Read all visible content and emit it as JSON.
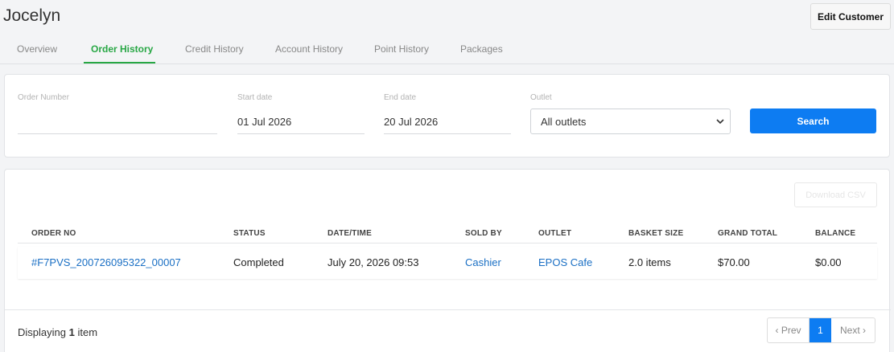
{
  "header": {
    "customer_name": "Jocelyn",
    "edit_button": "Edit Customer"
  },
  "tabs": [
    {
      "label": "Overview",
      "active": false
    },
    {
      "label": "Order History",
      "active": true
    },
    {
      "label": "Credit History",
      "active": false
    },
    {
      "label": "Account History",
      "active": false
    },
    {
      "label": "Point History",
      "active": false
    },
    {
      "label": "Packages",
      "active": false
    }
  ],
  "filters": {
    "order_number": {
      "label": "Order Number",
      "value": ""
    },
    "start_date": {
      "label": "Start date",
      "value": "01 Jul 2026"
    },
    "end_date": {
      "label": "End date",
      "value": "20 Jul 2026"
    },
    "outlet": {
      "label": "Outlet",
      "selected": "All outlets"
    },
    "search_button": "Search"
  },
  "results": {
    "download_button": "Download CSV",
    "columns": [
      "ORDER NO",
      "STATUS",
      "DATE/TIME",
      "SOLD BY",
      "OUTLET",
      "BASKET SIZE",
      "GRAND TOTAL",
      "BALANCE"
    ],
    "rows": [
      {
        "order_no": "#F7PVS_200726095322_00007",
        "status": "Completed",
        "datetime": "July 20, 2026 09:53",
        "sold_by": "Cashier",
        "outlet": "EPOS Cafe",
        "basket_size": "2.0 items",
        "grand_total": "$70.00",
        "balance": "$0.00"
      }
    ],
    "displaying_prefix": "Displaying",
    "displaying_count": "1",
    "displaying_suffix": "item"
  },
  "pagination": {
    "prev": "‹ Prev",
    "current_page": "1",
    "next": "Next ›"
  },
  "colors": {
    "accent_green": "#28a745",
    "primary_blue": "#0d7cf2",
    "link_blue": "#1a6fc4"
  }
}
